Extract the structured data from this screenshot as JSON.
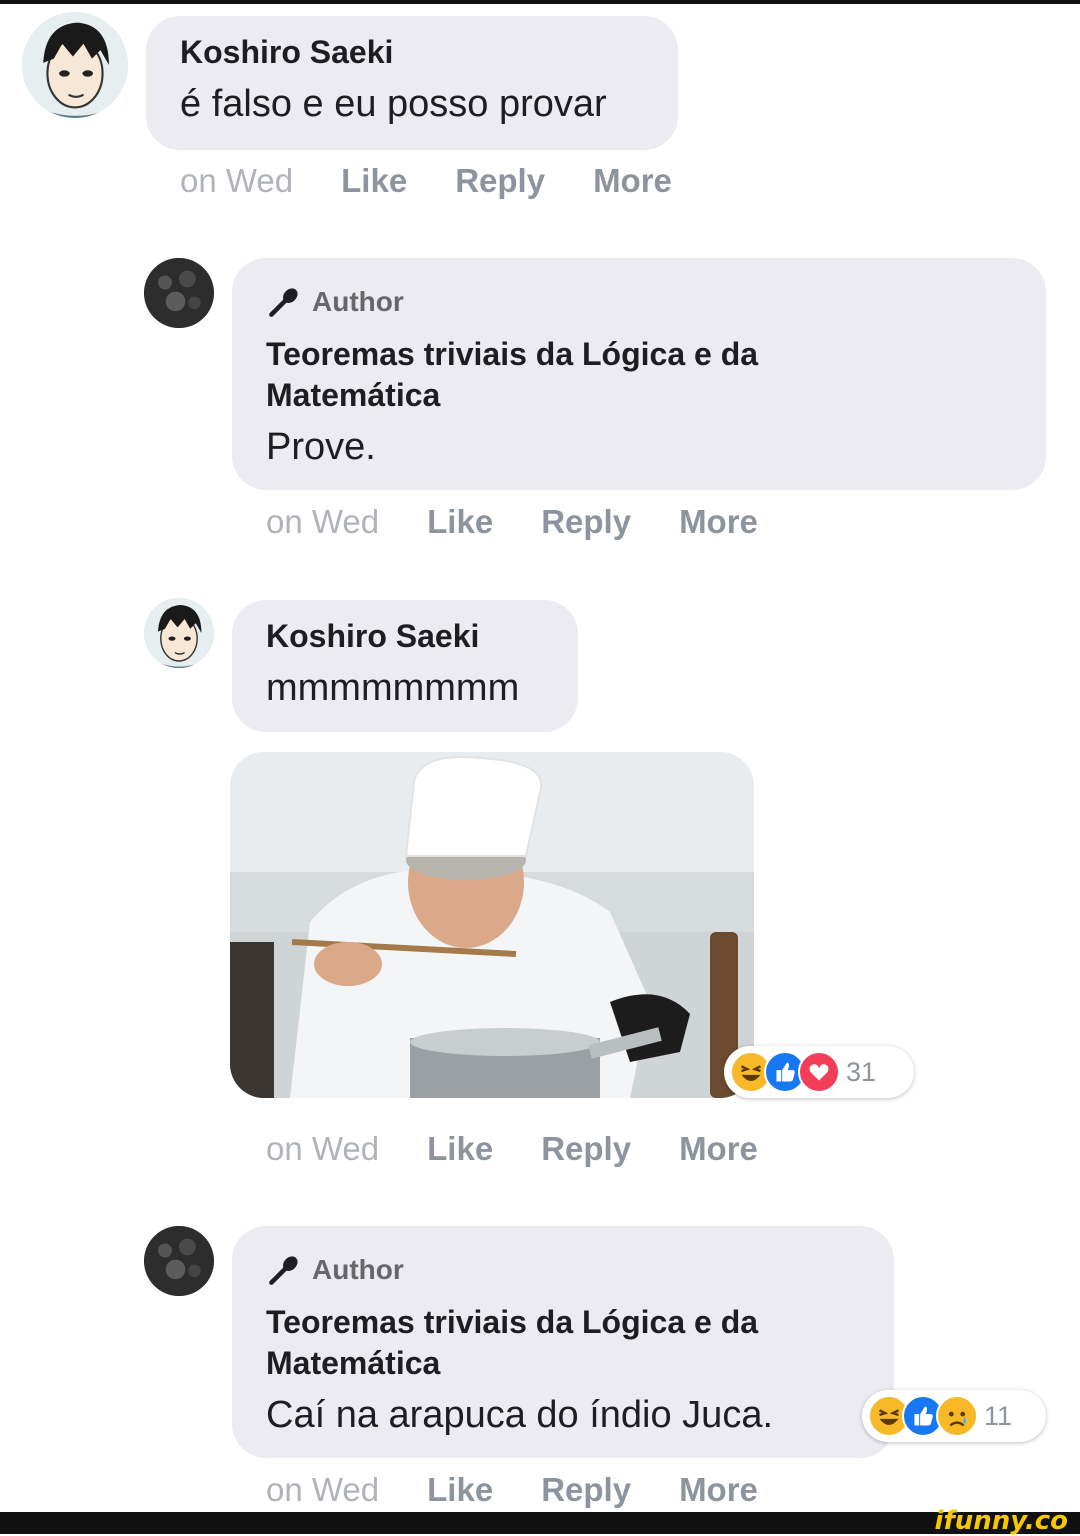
{
  "comments": [
    {
      "author": "Koshiro Saeki",
      "text": "é falso e eu posso provar",
      "time": "on Wed",
      "actions": [
        "Like",
        "Reply",
        "More"
      ]
    },
    {
      "badge": "Author",
      "author": "Teoremas triviais da Lógica e da Matemática",
      "author_line1": "Teoremas triviais da Lógica e da",
      "author_line2": "Matemática",
      "text": "Prove.",
      "time": "on Wed",
      "actions": [
        "Like",
        "Reply",
        "More"
      ]
    },
    {
      "author": "Koshiro Saeki",
      "text": "mmmmmmmm",
      "time": "on Wed",
      "actions": [
        "Like",
        "Reply",
        "More"
      ],
      "reactions": {
        "icons": [
          "haha-icon",
          "like-icon",
          "love-icon"
        ],
        "count": "31"
      }
    },
    {
      "badge": "Author",
      "author": "Teoremas triviais da Lógica e da Matemática",
      "author_line1": "Teoremas triviais da Lógica e da",
      "author_line2": "Matemática",
      "text": "Caí na arapuca do índio Juca.",
      "time": "on Wed",
      "actions": [
        "Like",
        "Reply",
        "More"
      ],
      "reactions": {
        "icons": [
          "haha-icon",
          "like-icon",
          "sad-icon"
        ],
        "count": "11"
      }
    }
  ],
  "watermark": "ifunny.co",
  "colors": {
    "bubble": "#ebebf1",
    "action_text": "#8d949e",
    "like_blue": "#1877f2",
    "love_red": "#f33e58",
    "haha_yellow": "#f7b928"
  }
}
